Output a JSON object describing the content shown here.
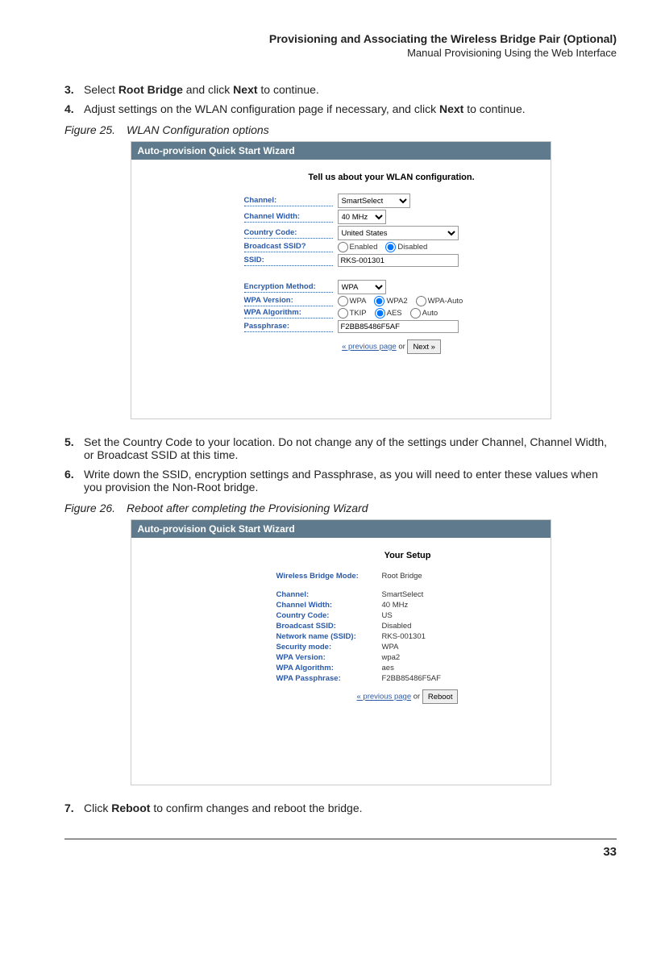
{
  "header": {
    "title": "Provisioning and Associating the Wireless Bridge Pair (Optional)",
    "subtitle": "Manual Provisioning Using the Web Interface"
  },
  "steps": {
    "s3": {
      "num": "3.",
      "pre": "Select ",
      "b1": "Root Bridge",
      "mid": " and click ",
      "b2": "Next",
      "post": " to continue."
    },
    "s4": {
      "num": "4.",
      "pre": "Adjust settings on the WLAN configuration page if necessary, and click ",
      "b1": "Next",
      "post": " to continue."
    },
    "s5": {
      "num": "5.",
      "text": "Set the Country Code to your location. Do not change any of the settings under Channel, Channel Width, or Broadcast SSID at this time."
    },
    "s6": {
      "num": "6.",
      "text": "Write down the SSID, encryption settings and Passphrase, as you will need to enter these values when you provision the Non-Root bridge."
    },
    "s7": {
      "num": "7.",
      "pre": "Click ",
      "b1": "Reboot",
      "post": " to confirm changes and reboot the bridge."
    }
  },
  "figs": {
    "f25": {
      "num": "Figure 25.",
      "cap": "WLAN Configuration options"
    },
    "f26": {
      "num": "Figure 26.",
      "cap": "Reboot after completing the Provisioning Wizard"
    }
  },
  "wiz1": {
    "title": "Auto-provision Quick Start Wizard",
    "heading": "Tell us about your WLAN configuration.",
    "labels": {
      "channel": "Channel:",
      "chwidth": "Channel Width:",
      "country": "Country Code:",
      "bssid": "Broadcast SSID?",
      "ssid": "SSID:",
      "enc": "Encryption Method:",
      "wpav": "WPA Version:",
      "wpaa": "WPA Algorithm:",
      "pass": "Passphrase:"
    },
    "values": {
      "channel": "SmartSelect",
      "chwidth": "40 MHz",
      "country": "United States",
      "ssid": "RKS-001301",
      "enc": "WPA",
      "pass": "F2BB85486F5AF"
    },
    "radios": {
      "enabled": "Enabled",
      "disabled": "Disabled",
      "wpa": "WPA",
      "wpa2": "WPA2",
      "wpaauto": "WPA-Auto",
      "tkip": "TKIP",
      "aes": "AES",
      "auto": "Auto"
    },
    "nav": {
      "prev": "« previous page",
      "or": " or ",
      "next": "Next »"
    }
  },
  "wiz2": {
    "title": "Auto-provision Quick Start Wizard",
    "heading": "Your Setup",
    "rows": {
      "mode_l": "Wireless Bridge Mode:",
      "mode_v": "Root Bridge",
      "ch_l": "Channel:",
      "ch_v": "SmartSelect",
      "cw_l": "Channel Width:",
      "cw_v": "40 MHz",
      "cc_l": "Country Code:",
      "cc_v": "US",
      "bs_l": "Broadcast SSID:",
      "bs_v": "Disabled",
      "nn_l": "Network name (SSID):",
      "nn_v": "RKS-001301",
      "sm_l": "Security mode:",
      "sm_v": "WPA",
      "wv_l": "WPA Version:",
      "wv_v": "wpa2",
      "wa_l": "WPA Algorithm:",
      "wa_v": "aes",
      "wp_l": "WPA Passphrase:",
      "wp_v": "F2BB85486F5AF"
    },
    "nav": {
      "prev": "« previous page",
      "or": " or ",
      "btn": "Reboot"
    }
  },
  "page": "33"
}
